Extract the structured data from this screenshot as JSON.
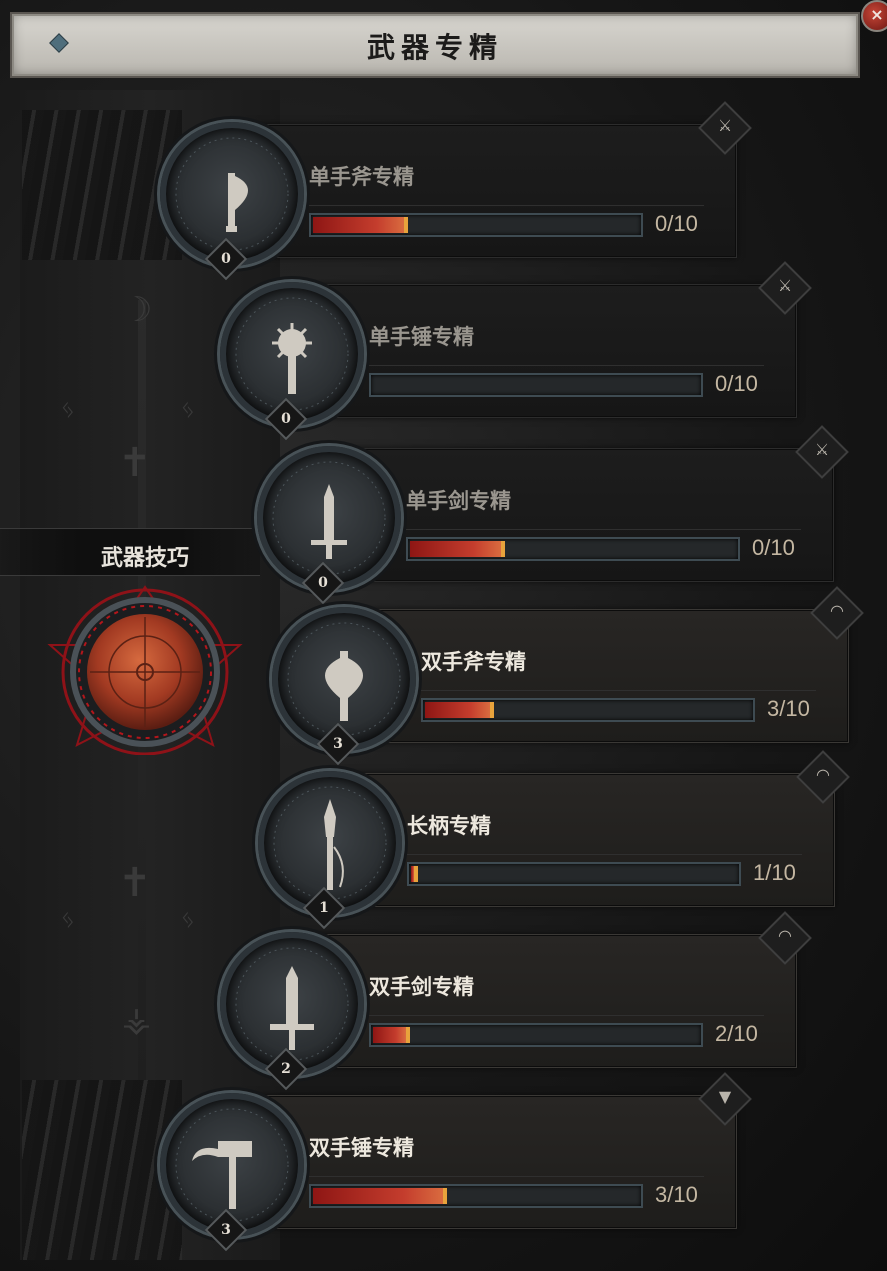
{
  "window": {
    "title": "武器专精",
    "close_glyph": "×"
  },
  "technique": {
    "label": "武器技巧"
  },
  "masteries": [
    {
      "name": "单手斧专精",
      "points": "0",
      "rank": "0/10",
      "progress": 0.28,
      "state": "inactive",
      "icon": "one-handed-axe-icon",
      "badge_icon": "crossed-axes-icon"
    },
    {
      "name": "单手锤专精",
      "points": "0",
      "rank": "0/10",
      "progress": 0.0,
      "state": "inactive",
      "icon": "one-handed-mace-icon",
      "badge_icon": "crossed-axes-icon"
    },
    {
      "name": "单手剑专精",
      "points": "0",
      "rank": "0/10",
      "progress": 0.28,
      "state": "inactive",
      "icon": "one-handed-sword-icon",
      "badge_icon": "crossed-axes-icon"
    },
    {
      "name": "双手斧专精",
      "points": "3",
      "rank": "3/10",
      "progress": 0.2,
      "state": "active",
      "icon": "two-handed-axe-icon",
      "badge_icon": "signal-icon"
    },
    {
      "name": "长柄专精",
      "points": "1",
      "rank": "1/10",
      "progress": 0.01,
      "state": "active",
      "icon": "polearm-icon",
      "badge_icon": "signal-icon"
    },
    {
      "name": "双手剑专精",
      "points": "2",
      "rank": "2/10",
      "progress": 0.1,
      "state": "active",
      "icon": "two-handed-sword-icon",
      "badge_icon": "signal-icon"
    },
    {
      "name": "双手锤专精",
      "points": "3",
      "rank": "3/10",
      "progress": 0.4,
      "state": "active",
      "icon": "two-handed-hammer-icon",
      "badge_icon": "anvil-icon"
    }
  ],
  "colors": {
    "bar_fill_start": "#8e1614",
    "bar_fill_end": "#d96b3f",
    "bar_tip": "#e8a33c",
    "orb": "#b8492a",
    "ring_red": "#b3161b"
  }
}
